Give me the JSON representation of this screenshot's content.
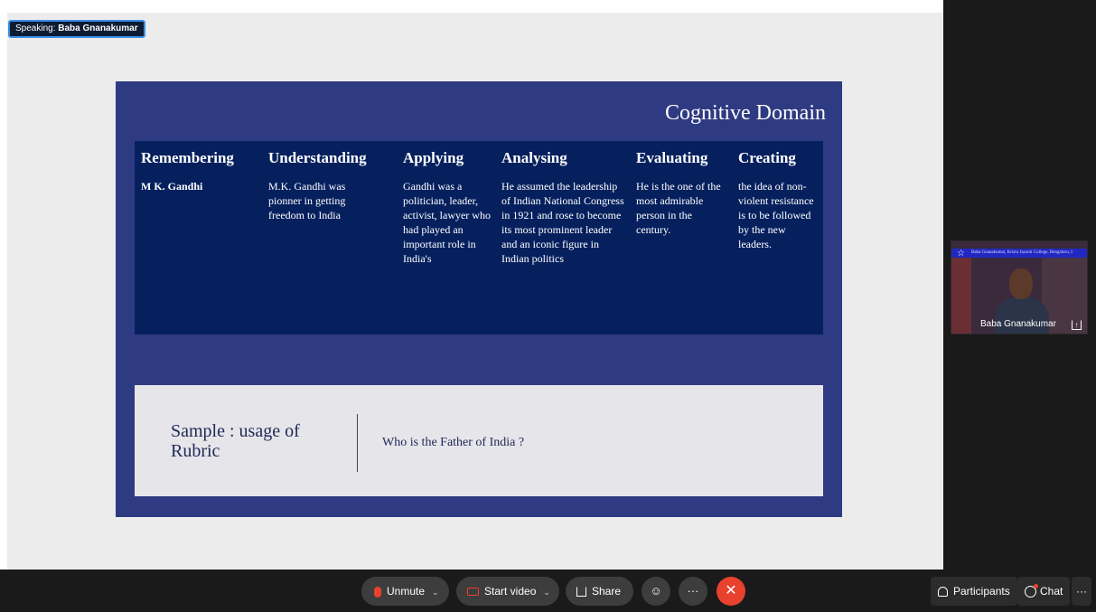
{
  "speaking": {
    "prefix": "Speaking:",
    "name": "Baba Gnanakumar"
  },
  "slide": {
    "title": "Cognitive Domain",
    "columns": [
      {
        "heading": "Remembering",
        "body": "M K. Gandhi"
      },
      {
        "heading": "Understanding",
        "body": "M.K. Gandhi was pionner in getting freedom to India"
      },
      {
        "heading": "Applying",
        "body": " Gandhi was a politician, leader, activist, lawyer who had played an important role in India's"
      },
      {
        "heading": "Analysing",
        "body": "He assumed the leadership of Indian National Congress in 1921 and rose to become its most prominent leader and an iconic figure in Indian politics"
      },
      {
        "heading": "Evaluating",
        "body": "He is the one of the most admirable person in the century."
      },
      {
        "heading": "Creating",
        "body": "the idea of non-violent resistance is to be followed by the new leaders."
      }
    ],
    "rubric_label": "Sample : usage of Rubric",
    "rubric_question": "Who is the Father of India ?"
  },
  "video": {
    "banner_text": "Baba Gnanakumar, Kristu Jayanti College, Bengaluru, I",
    "participant_name": "Baba Gnanakumar"
  },
  "toolbar": {
    "unmute": "Unmute",
    "start_video": "Start video",
    "share": "Share",
    "participants": "Participants",
    "chat": "Chat",
    "accent_red": "#e8412e"
  }
}
